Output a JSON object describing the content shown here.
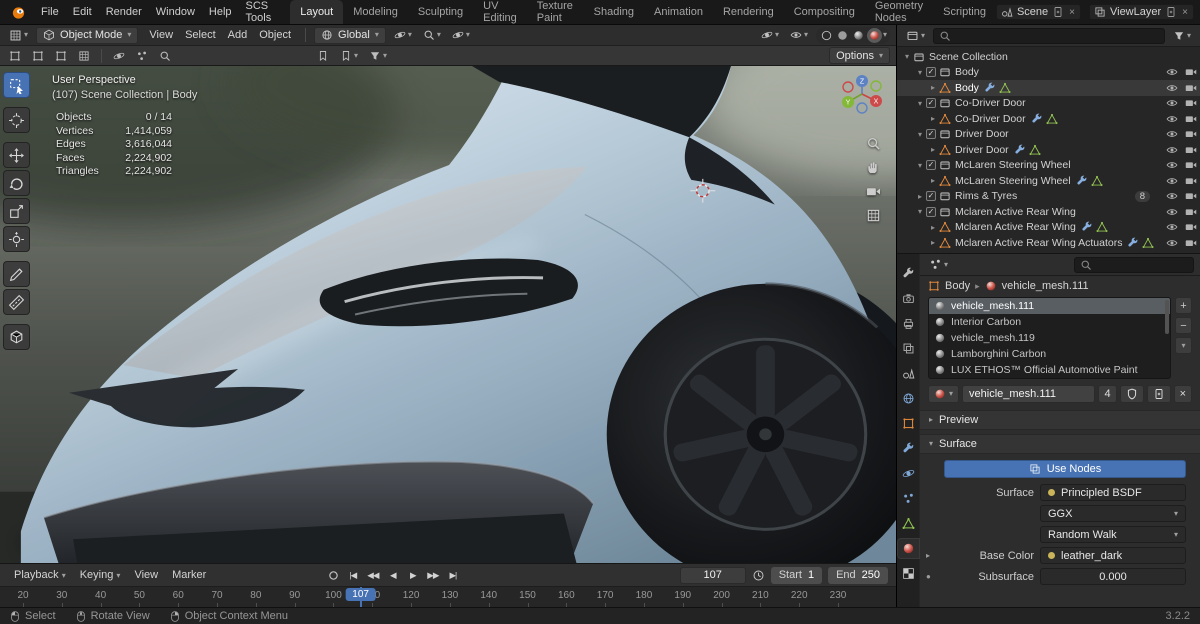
{
  "colors": {
    "accent": "#4772b3",
    "object_orange": "#e0883c",
    "data_green": "#92c050",
    "modifier_blue": "#86aede"
  },
  "topbar": {
    "menus": [
      "File",
      "Edit",
      "Render",
      "Window",
      "Help",
      "SCS Tools"
    ],
    "tabs": [
      "Layout",
      "Modeling",
      "Sculpting",
      "UV Editing",
      "Texture Paint",
      "Shading",
      "Animation",
      "Rendering",
      "Compositing",
      "Geometry Nodes",
      "Scripting"
    ],
    "active_tab": "Layout",
    "scene": {
      "label": "Scene"
    },
    "viewlayer": {
      "label": "ViewLayer"
    }
  },
  "viewport_header": {
    "mode": "Object Mode",
    "menus": [
      "View",
      "Select",
      "Add",
      "Object"
    ],
    "orientation": "Global",
    "options": "Options"
  },
  "viewport": {
    "view_label": "User Perspective",
    "context_label": "(107) Scene Collection | Body",
    "stats": [
      {
        "label": "Objects",
        "value": "0 / 14"
      },
      {
        "label": "Vertices",
        "value": "1,414,059"
      },
      {
        "label": "Edges",
        "value": "3,616,044"
      },
      {
        "label": "Faces",
        "value": "2,224,902"
      },
      {
        "label": "Triangles",
        "value": "2,224,902"
      }
    ],
    "tools": [
      "select-box",
      "cursor",
      "move",
      "rotate",
      "scale",
      "transform",
      "annotate",
      "measure",
      "add-cube"
    ],
    "active_tool": "select-box"
  },
  "outliner": {
    "rows": [
      {
        "indent": 0,
        "type": "collection",
        "disclosure": "expanded",
        "label": "Scene Collection",
        "eye": false,
        "cam": false
      },
      {
        "indent": 1,
        "type": "collection",
        "disclosure": "expanded",
        "checkbox": true,
        "label": "Body"
      },
      {
        "indent": 2,
        "type": "object",
        "disclosure": "collapsed",
        "label": "Body",
        "trailing": [
          "modifier",
          "meshdata"
        ],
        "active": true
      },
      {
        "indent": 1,
        "type": "collection",
        "disclosure": "expanded",
        "checkbox": true,
        "label": "Co-Driver Door"
      },
      {
        "indent": 2,
        "type": "object",
        "disclosure": "collapsed",
        "label": "Co-Driver Door",
        "trailing": [
          "modifier",
          "meshdata"
        ]
      },
      {
        "indent": 1,
        "type": "collection",
        "disclosure": "expanded",
        "checkbox": true,
        "label": "Driver Door"
      },
      {
        "indent": 2,
        "type": "object",
        "disclosure": "collapsed",
        "label": "Driver Door",
        "trailing": [
          "modifier",
          "meshdata"
        ]
      },
      {
        "indent": 1,
        "type": "collection",
        "disclosure": "expanded",
        "checkbox": true,
        "label": "McLaren Steering Wheel"
      },
      {
        "indent": 2,
        "type": "object",
        "disclosure": "collapsed",
        "label": "McLaren Steering Wheel",
        "trailing": [
          "modifier",
          "meshdata"
        ]
      },
      {
        "indent": 1,
        "type": "collection",
        "disclosure": "collapsed",
        "checkbox": true,
        "label": "Rims & Tyres",
        "badge": "8"
      },
      {
        "indent": 1,
        "type": "collection",
        "disclosure": "expanded",
        "checkbox": true,
        "label": "Mclaren Active Rear Wing"
      },
      {
        "indent": 2,
        "type": "object",
        "disclosure": "collapsed",
        "label": "Mclaren Active Rear Wing",
        "trailing": [
          "modifier",
          "meshdata"
        ]
      },
      {
        "indent": 2,
        "type": "object",
        "disclosure": "collapsed",
        "label": "Mclaren Active Rear Wing Actuators",
        "trailing": [
          "modifier",
          "meshdata"
        ]
      }
    ]
  },
  "properties": {
    "breadcrumb": {
      "object": "Body",
      "data": "vehicle_mesh.111"
    },
    "slots": [
      {
        "label": "vehicle_mesh.111",
        "selected": true
      },
      {
        "label": "Interior Carbon"
      },
      {
        "label": "vehicle_mesh.119"
      },
      {
        "label": "Lamborghini Carbon"
      },
      {
        "label": "LUX ETHOS™ Official Automotive Paint"
      }
    ],
    "material_name": "vehicle_mesh.111",
    "users_count": "4",
    "panel_preview": "Preview",
    "panel_surface": "Surface",
    "use_nodes": "Use Nodes",
    "surface_label": "Surface",
    "surface_value": "Principled BSDF",
    "distribution": "GGX",
    "subsurface_method": "Random Walk",
    "base_color_label": "Base Color",
    "base_color_value": "leather_dark",
    "subsurface_label": "Subsurface",
    "subsurface_value": "0.000",
    "tabs": [
      "tool",
      "render",
      "output",
      "viewlayer",
      "scene",
      "world",
      "object",
      "modifiers",
      "physics",
      "particles",
      "data",
      "material",
      "texture"
    ],
    "active_tab": "material"
  },
  "timeline": {
    "menus": [
      "Playback",
      "Keying",
      "View",
      "Marker"
    ],
    "transport": [
      "jump-start",
      "prev-key",
      "play-reverse",
      "play",
      "next-key",
      "jump-end"
    ],
    "current_frame": "107",
    "start_label": "Start",
    "start_value": "1",
    "end_label": "End",
    "end_value": "250",
    "playhead": 107,
    "ticks": [
      20,
      30,
      40,
      50,
      60,
      70,
      80,
      90,
      100,
      110,
      120,
      130,
      140,
      150,
      160,
      170,
      180,
      190,
      200,
      210,
      220,
      230
    ]
  },
  "statusbar": {
    "hints": [
      {
        "button": "left",
        "label": "Select"
      },
      {
        "button": "middle",
        "label": "Rotate View"
      },
      {
        "button": "right",
        "label": "Object Context Menu"
      }
    ],
    "version": "3.2.2"
  }
}
